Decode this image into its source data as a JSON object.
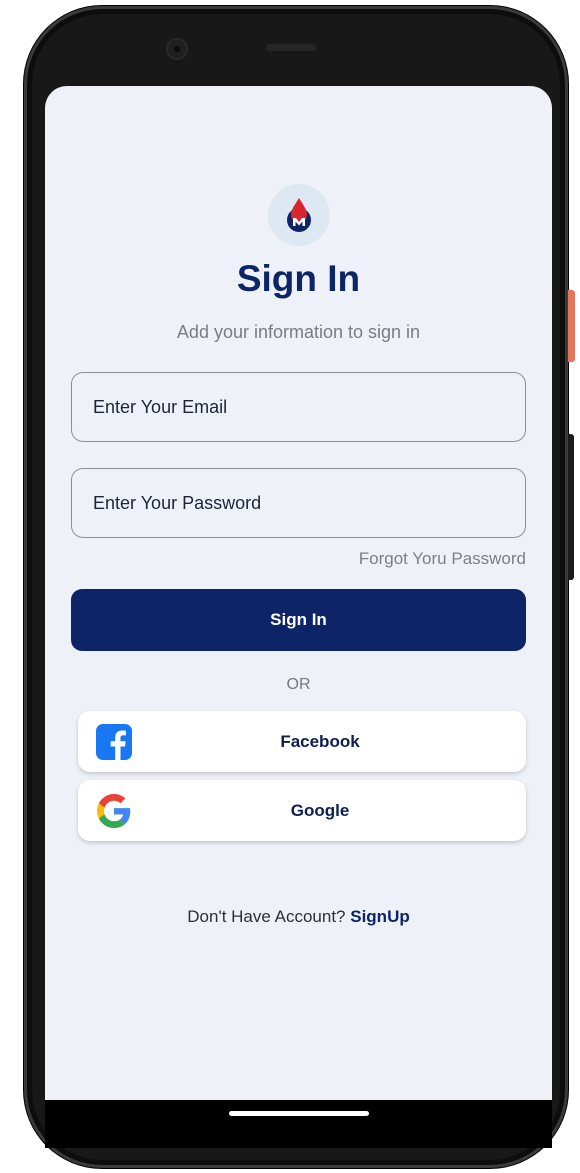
{
  "header": {
    "title": "Sign In",
    "subtitle": "Add your information to sign in"
  },
  "form": {
    "email_placeholder": "Enter Your Email",
    "password_placeholder": "Enter Your Password",
    "forgot_password_label": "Forgot Yoru Password",
    "signin_label": "Sign In",
    "divider_label": "OR"
  },
  "social": {
    "facebook_label": "Facebook",
    "google_label": "Google"
  },
  "footer": {
    "prompt": "Don't Have Account?",
    "signup_label": "SignUp"
  },
  "colors": {
    "primary": "#0d2566",
    "background": "#eef2f8",
    "logo_red": "#d8262f",
    "facebook_blue": "#1877f2"
  }
}
